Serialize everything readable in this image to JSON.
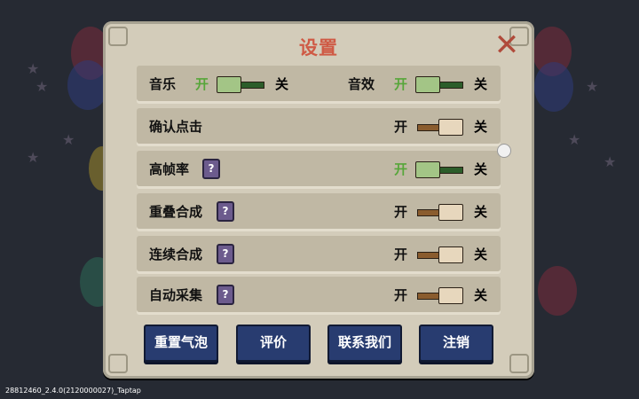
{
  "dialog": {
    "title": "设置",
    "close_icon": "close-x-icon"
  },
  "labels": {
    "on": "开",
    "off": "关",
    "help": "?"
  },
  "colors": {
    "on_label": "#57a63a",
    "off_label": "#111111",
    "title": "#cf5a45",
    "button_bg": "#283c70"
  },
  "rows": [
    {
      "items": [
        {
          "label": "音乐",
          "state": "on"
        },
        {
          "label": "音效",
          "state": "on"
        }
      ]
    },
    {
      "label": "确认点击",
      "help": false,
      "state": "off"
    },
    {
      "label": "高帧率",
      "help": true,
      "state": "on"
    },
    {
      "label": "重叠合成",
      "help": true,
      "state": "off"
    },
    {
      "label": "连续合成",
      "help": true,
      "state": "off"
    },
    {
      "label": "自动采集",
      "help": true,
      "state": "off"
    }
  ],
  "buttons": {
    "reset": "重置气泡",
    "rate": "评价",
    "contact": "联系我们",
    "logout": "注销"
  },
  "footer": {
    "version": "28812460_2.4.0(2120000027)_Taptap"
  }
}
